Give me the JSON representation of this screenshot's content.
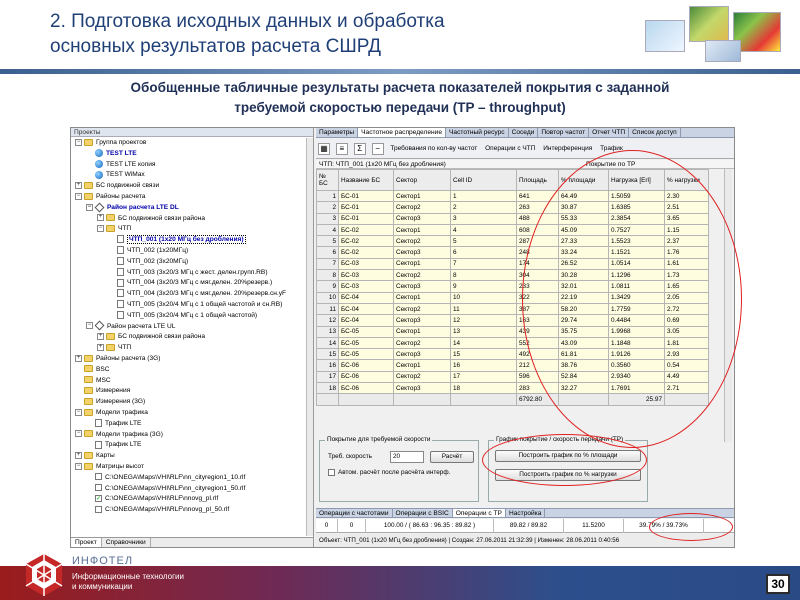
{
  "slide": {
    "title_line1": "2. Подготовка исходных данных и обработка",
    "title_line2": "основных результатов расчета СШРД",
    "subtitle_line1": "Обобщенные табличные результаты расчета показателей покрытия с заданной",
    "subtitle_line2": "требуемой скоростью передачи (TP – throughput)",
    "page_number": "30"
  },
  "footer": {
    "company": "ИНФОТЕЛ",
    "line1": "Информационные технологии",
    "line2": "и коммуникации"
  },
  "left_panel": {
    "title": "Проекты",
    "tree": [
      {
        "indent": 0,
        "pm": "−",
        "icon": "folder",
        "label": "Группа проектов"
      },
      {
        "indent": 1,
        "pm": "",
        "icon": "globe",
        "label": "TEST LTE",
        "bold": true,
        "blue": true
      },
      {
        "indent": 1,
        "pm": "",
        "icon": "globe",
        "label": "TEST LTE копия"
      },
      {
        "indent": 1,
        "pm": "",
        "icon": "globe",
        "label": "TEST WiMax"
      },
      {
        "indent": 0,
        "pm": "+",
        "icon": "folder",
        "label": "БС подвижной связи"
      },
      {
        "indent": 0,
        "pm": "−",
        "icon": "folder",
        "label": "Районы расчета"
      },
      {
        "indent": 1,
        "pm": "−",
        "icon": "diamond",
        "label": "Район расчета LTE DL",
        "bold": true,
        "blue": true
      },
      {
        "indent": 2,
        "pm": "+",
        "icon": "folder",
        "label": "БС подвижной связи района"
      },
      {
        "indent": 2,
        "pm": "−",
        "icon": "folder",
        "label": "ЧТП"
      },
      {
        "indent": 3,
        "pm": "",
        "icon": "doc",
        "label": "ЧТП_001 (1x20 МГц без дробления)",
        "bold": true,
        "blue": true,
        "selected": true
      },
      {
        "indent": 3,
        "pm": "",
        "icon": "doc",
        "label": "ЧТП_002 (1x20МГц)"
      },
      {
        "indent": 3,
        "pm": "",
        "icon": "doc",
        "label": "ЧТП_002 (3x20МГц)"
      },
      {
        "indent": 3,
        "pm": "",
        "icon": "doc",
        "label": "ЧТП_003 (3x20/3 МГц с жест. делен.групп.RB)"
      },
      {
        "indent": 3,
        "pm": "",
        "icon": "doc",
        "label": "ЧТП_004 (3x20/3 МГц с мяг.делен. 20%резерв.)"
      },
      {
        "indent": 3,
        "pm": "",
        "icon": "doc",
        "label": "ЧТП_004 (3x20/3 МГц с мяг.делен. 20%резерв.сн.уF"
      },
      {
        "indent": 3,
        "pm": "",
        "icon": "doc",
        "label": "ЧТП_005 (3x20/4 МГц с 1 общей частотой и сн.RB)"
      },
      {
        "indent": 3,
        "pm": "",
        "icon": "doc",
        "label": "ЧТП_005 (3x20/4 МГц с 1 общей частотой)"
      },
      {
        "indent": 1,
        "pm": "−",
        "icon": "diamond",
        "label": "Район расчета LTE UL"
      },
      {
        "indent": 2,
        "pm": "+",
        "icon": "folder",
        "label": "БС подвижной связи района"
      },
      {
        "indent": 2,
        "pm": "+",
        "icon": "folder",
        "label": "ЧТП"
      },
      {
        "indent": 0,
        "pm": "+",
        "icon": "folder",
        "label": "Районы расчета (3G)"
      },
      {
        "indent": 0,
        "pm": "",
        "icon": "folder",
        "label": "BSC"
      },
      {
        "indent": 0,
        "pm": "",
        "icon": "folder",
        "label": "MSC"
      },
      {
        "indent": 0,
        "pm": "",
        "icon": "folder",
        "label": "Измерения"
      },
      {
        "indent": 0,
        "pm": "",
        "icon": "folder",
        "label": "Измерения (3G)"
      },
      {
        "indent": 0,
        "pm": "−",
        "icon": "folder",
        "label": "Модели трафика"
      },
      {
        "indent": 1,
        "pm": "",
        "icon": "doc",
        "label": "Трафик LTE"
      },
      {
        "indent": 0,
        "pm": "−",
        "icon": "folder",
        "label": "Модели трафика (3G)"
      },
      {
        "indent": 1,
        "pm": "",
        "icon": "doc",
        "label": "Трафик LTE"
      },
      {
        "indent": 0,
        "pm": "+",
        "icon": "folder",
        "label": "Карты"
      },
      {
        "indent": 0,
        "pm": "−",
        "icon": "folder",
        "label": "Матрицы высот"
      },
      {
        "indent": 1,
        "pm": "",
        "icon": "check",
        "label": "C:\\ONEGA\\Maps\\VHI\\RLF\\nn_cityregion1_10.rlf"
      },
      {
        "indent": 1,
        "pm": "",
        "icon": "check",
        "label": "C:\\ONEGA\\Maps\\VHI\\RLF\\nn_cityregion1_50.rlf"
      },
      {
        "indent": 1,
        "pm": "",
        "icon": "check",
        "label": "C:\\ONEGA\\Maps\\VHI\\RLF\\nnovg_pl.rlf",
        "checked": true
      },
      {
        "indent": 1,
        "pm": "",
        "icon": "check",
        "label": "C:\\ONEGA\\Maps\\VHI\\RLF\\nnovg_pl_50.rlf"
      }
    ],
    "bottom_tabs": [
      "Проект",
      "Справочники"
    ]
  },
  "right_panel": {
    "tabs": [
      "Параметры",
      "Частотное распределение",
      "Частотный ресурс",
      "Соседи",
      "Повтор частот",
      "Отчет ЧТП",
      "Список доступ"
    ],
    "active_tab": 1,
    "toolbar": {
      "btn1": "Требования по кол-ву частот",
      "btn2": "Операции с ЧТП",
      "btn3": "Интерференция",
      "btn4": "Трафик"
    },
    "grid_caption": "ЧТП: ЧТП_001 (1x20 МГц без дробления)",
    "grid_group_header": "Покрытие по ТР",
    "columns": [
      "№ БС",
      "Название БС",
      "Сектор",
      "Cell ID",
      "Площадь",
      "% площади",
      "Нагрузка [Erl]",
      "% нагрузки"
    ],
    "rows": [
      [
        "1",
        "БС-01",
        "Сектор1",
        "1",
        "641",
        "64.49",
        "1.5059",
        "2.30"
      ],
      [
        "2",
        "БС-01",
        "Сектор2",
        "2",
        "263",
        "30.87",
        "1.6385",
        "2.51"
      ],
      [
        "3",
        "БС-01",
        "Сектор3",
        "3",
        "488",
        "55.33",
        "2.3854",
        "3.65"
      ],
      [
        "4",
        "БС-02",
        "Сектор1",
        "4",
        "608",
        "45.09",
        "0.7527",
        "1.15"
      ],
      [
        "5",
        "БС-02",
        "Сектор2",
        "5",
        "287",
        "27.33",
        "1.5523",
        "2.37"
      ],
      [
        "6",
        "БС-02",
        "Сектор3",
        "6",
        "248",
        "33.24",
        "1.1521",
        "1.76"
      ],
      [
        "7",
        "БС-03",
        "Сектор1",
        "7",
        "174",
        "26.52",
        "1.0514",
        "1.61"
      ],
      [
        "8",
        "БС-03",
        "Сектор2",
        "8",
        "304",
        "30.28",
        "1.1296",
        "1.73"
      ],
      [
        "9",
        "БС-03",
        "Сектор3",
        "9",
        "233",
        "32.01",
        "1.0811",
        "1.65"
      ],
      [
        "10",
        "БС-04",
        "Сектор1",
        "10",
        "322",
        "22.19",
        "1.3429",
        "2.05"
      ],
      [
        "11",
        "БС-04",
        "Сектор2",
        "11",
        "387",
        "58.20",
        "1.7759",
        "2.72"
      ],
      [
        "12",
        "БС-04",
        "Сектор3",
        "12",
        "163",
        "29.74",
        "0.4484",
        "0.69"
      ],
      [
        "13",
        "БС-05",
        "Сектор1",
        "13",
        "439",
        "35.75",
        "1.9968",
        "3.05"
      ],
      [
        "14",
        "БС-05",
        "Сектор2",
        "14",
        "552",
        "43.09",
        "1.1848",
        "1.81"
      ],
      [
        "15",
        "БС-05",
        "Сектор3",
        "15",
        "492",
        "61.81",
        "1.9126",
        "2.93"
      ],
      [
        "16",
        "БС-06",
        "Сектор1",
        "16",
        "212",
        "38.76",
        "0.3560",
        "0.54"
      ],
      [
        "17",
        "БС-06",
        "Сектор2",
        "17",
        "596",
        "52.84",
        "2.9340",
        "4.49"
      ],
      [
        "18",
        "БС-06",
        "Сектор3",
        "18",
        "283",
        "32.27",
        "1.7691",
        "2.71"
      ]
    ],
    "totals": {
      "area": "6792.80",
      "load": "25.97"
    },
    "coverage_box": {
      "title": "Покрытие для требуемой скорости",
      "speed_label": "Треб. скорость",
      "speed_value": "20",
      "calc_button": "Расчёт",
      "auto_checkbox": "Автом. расчёт после расчёта интерф."
    },
    "graph_box": {
      "title": "График покрытие / скорость передачи (ТР)",
      "btn_area": "Построить график по % площади",
      "btn_load": "Построить график по % нагрузки"
    },
    "bottom_tabs": [
      "Операции с частотами",
      "Операции с BSIC",
      "Операции с ТР",
      "Настройка"
    ],
    "bottom_active_tab": 2,
    "summary": [
      "0",
      "0",
      "100.00 / ( 86.63 : 96.35 : 89.82 )",
      "89.82 / 89.82",
      "11.5200",
      "39.79% / 39.73%"
    ],
    "status": "Объект: ЧТП_001 (1x20 МГц без дробления)   |   Создан: 27.06.2011 21:32:39   |   Изменен: 28.06.2011 0:40:56"
  }
}
